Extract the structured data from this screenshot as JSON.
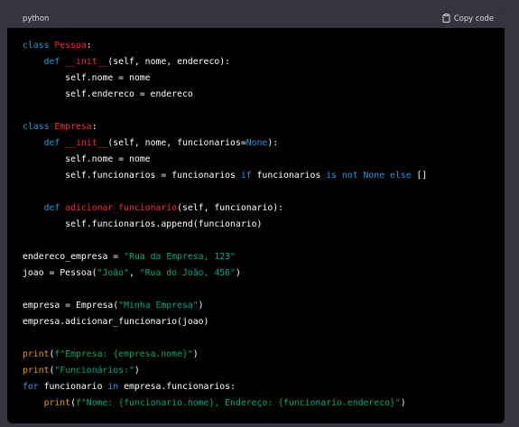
{
  "header": {
    "language": "python",
    "copy_label": "Copy code"
  },
  "code": [
    [
      [
        "kw",
        "class"
      ],
      [
        "d",
        " "
      ],
      [
        "cls",
        "Pessoa"
      ],
      [
        "d",
        ":"
      ]
    ],
    [
      [
        "d",
        "    "
      ],
      [
        "kw",
        "def"
      ],
      [
        "d",
        " "
      ],
      [
        "cls",
        "__init__"
      ],
      [
        "d",
        "(self, nome, endereco):"
      ]
    ],
    [
      [
        "d",
        "        self.nome = nome"
      ]
    ],
    [
      [
        "d",
        "        self.endereco = endereco"
      ]
    ],
    [],
    [
      [
        "kw",
        "class"
      ],
      [
        "d",
        " "
      ],
      [
        "cls",
        "Empresa"
      ],
      [
        "d",
        ":"
      ]
    ],
    [
      [
        "d",
        "    "
      ],
      [
        "kw",
        "def"
      ],
      [
        "d",
        " "
      ],
      [
        "cls",
        "__init__"
      ],
      [
        "d",
        "(self, nome, funcionarios="
      ],
      [
        "kw",
        "None"
      ],
      [
        "d",
        "):"
      ]
    ],
    [
      [
        "d",
        "        self.nome = nome"
      ]
    ],
    [
      [
        "d",
        "        self.funcionarios = funcionarios "
      ],
      [
        "kw",
        "if"
      ],
      [
        "d",
        " funcionarios "
      ],
      [
        "kw",
        "is"
      ],
      [
        "d",
        " "
      ],
      [
        "kw",
        "not"
      ],
      [
        "d",
        " "
      ],
      [
        "kw",
        "None"
      ],
      [
        "d",
        " "
      ],
      [
        "kw",
        "else"
      ],
      [
        "d",
        " []"
      ]
    ],
    [],
    [
      [
        "d",
        "    "
      ],
      [
        "kw",
        "def"
      ],
      [
        "d",
        " "
      ],
      [
        "cls",
        "adicionar_funcionario"
      ],
      [
        "d",
        "(self, funcionario):"
      ]
    ],
    [
      [
        "d",
        "        self.funcionarios.append(funcionario)"
      ]
    ],
    [],
    [
      [
        "d",
        "endereco_empresa = "
      ],
      [
        "str",
        "\"Rua da Empresa, 123\""
      ]
    ],
    [
      [
        "d",
        "joao = Pessoa("
      ],
      [
        "str",
        "\"João\""
      ],
      [
        "d",
        ", "
      ],
      [
        "str",
        "\"Rua do João, 456\""
      ],
      [
        "d",
        ")"
      ]
    ],
    [],
    [
      [
        "d",
        "empresa = Empresa("
      ],
      [
        "str",
        "\"Minha Empresa\""
      ],
      [
        "d",
        ")"
      ]
    ],
    [
      [
        "d",
        "empresa.adicionar_funcionario(joao)"
      ]
    ],
    [],
    [
      [
        "fn",
        "print"
      ],
      [
        "d",
        "("
      ],
      [
        "str",
        "f\"Empresa: {empresa.nome}\""
      ],
      [
        "d",
        ")"
      ]
    ],
    [
      [
        "fn",
        "print"
      ],
      [
        "d",
        "("
      ],
      [
        "str",
        "\"Funcionários:\""
      ],
      [
        "d",
        ")"
      ]
    ],
    [
      [
        "kw",
        "for"
      ],
      [
        "d",
        " funcionario "
      ],
      [
        "kw",
        "in"
      ],
      [
        "d",
        " empresa.funcionarios:"
      ]
    ],
    [
      [
        "d",
        "    "
      ],
      [
        "fn",
        "print"
      ],
      [
        "d",
        "("
      ],
      [
        "str",
        "f\"Nome: {funcionario.nome}, Endereço: {funcionario.endereco}\""
      ],
      [
        "d",
        ")"
      ]
    ]
  ]
}
